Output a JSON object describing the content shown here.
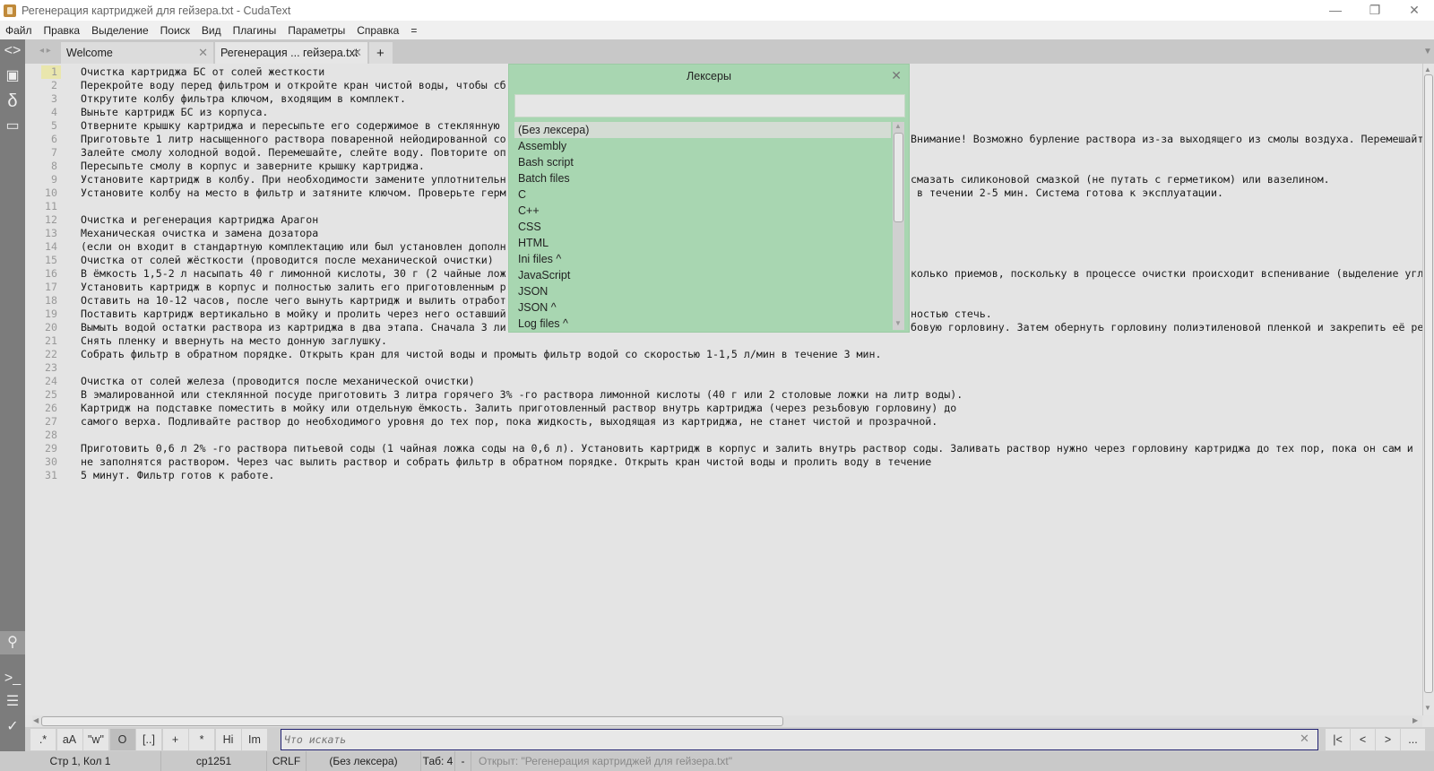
{
  "window": {
    "title": "Регенерация картриджей для гейзера.txt - CudaText",
    "minimize": "—",
    "restore": "❐",
    "close": "✕"
  },
  "menu": [
    "Файл",
    "Правка",
    "Выделение",
    "Поиск",
    "Вид",
    "Плагины",
    "Параметры",
    "Справка",
    "="
  ],
  "tabs": [
    {
      "label": "Welcome",
      "close": "✕"
    },
    {
      "label": "Регенерация ... гейзера.txt",
      "close": "✕"
    }
  ],
  "add_tab": "+",
  "lines": [
    {
      "n": "1",
      "t": "Очистка картриджа БС от солей жесткости"
    },
    {
      "n": "2",
      "t": "Перекройте воду перед фильтром и откройте кран чистой воды, чтобы сб"
    },
    {
      "n": "3",
      "t": "Открутите колбу фильтра ключом, входящим в комплект."
    },
    {
      "n": "4",
      "t": "Выньте картридж БС из корпуса."
    },
    {
      "n": "5",
      "t": "Отверните крышку картриджа и пересыпьте его содержимое в стеклянную"
    },
    {
      "n": "6",
      "t": "Приготовьте 1 литр насыщенного раствора поваренной нейодированной со",
      "r": "Внимание! Возможно бурление раствора из-за выходящего из смолы воздуха. Перемешайт"
    },
    {
      "n": "7",
      "t": "Залейте смолу холодной водой. Перемешайте, слейте воду. Повторите оп"
    },
    {
      "n": "8",
      "t": "Пересыпьте смолу в корпус и заверните крышку картриджа."
    },
    {
      "n": "9",
      "t": "Установите картридж в колбу. При необходимости замените уплотнительн",
      "r": "смазать силиконовой смазкой (не путать с герметиком) или вазелином."
    },
    {
      "n": "10",
      "t": "Установите колбу на место в фильтр и затяните ключом. Проверьте герм",
      "r": " в течении 2-5 мин. Система готова к эксплуатации."
    },
    {
      "n": "11",
      "t": ""
    },
    {
      "n": "12",
      "t": "Очистка и регенерация картриджа Арагон"
    },
    {
      "n": "13",
      "t": "Механическая очистка и замена дозатора"
    },
    {
      "n": "14",
      "t": "(если он входит в стандартную комплектацию или был установлен дополн"
    },
    {
      "n": "15",
      "t": "Очистка от солей жёсткости (проводится после механической очистки)"
    },
    {
      "n": "16",
      "t": "В ёмкость 1,5-2 л насыпать 40 г лимонной кислоты, 30 г (2 чайные лож",
      "r": "колько приемов, поскольку в процессе очистки происходит вспенивание (выделение угл"
    },
    {
      "n": "17",
      "t": "Установить картридж в корпус и полностью залить его приготовленным р"
    },
    {
      "n": "18",
      "t": "Оставить на 10-12 часов, после чего вынуть картридж и вылить отработ"
    },
    {
      "n": "19",
      "t": "Поставить картридж вертикально в мойку и пролить через него оставший",
      "r": "ностью стечь."
    },
    {
      "n": "20",
      "t": "Вымыть водой остатки раствора из картриджа в два этапа. Сначала 3 ли",
      "r": "бовую горловину. Затем обернуть горловину полиэтиленовой пленкой и закрепить её ре"
    },
    {
      "n": "21",
      "t": "Снять пленку и ввернуть на место донную заглушку."
    },
    {
      "n": "22",
      "t": "Собрать фильтр в обратном порядке. Открыть кран для чистой воды и промыть фильтр водой со скоростью 1-1,5 л/мин в течение 3 мин."
    },
    {
      "n": "23",
      "t": ""
    },
    {
      "n": "24",
      "t": "Очистка от солей железа (проводится после механической очистки)"
    },
    {
      "n": "25",
      "t": "В эмалированной или стеклянной посуде приготовить 3 литра горячего 3% -го раствора лимонной кислоты (40 г или 2 столовые ложки на литр воды)."
    },
    {
      "n": "26",
      "t": "Картридж на подставке поместить в мойку или отдельную ёмкость. Залить приготовленный раствор внутрь картриджа (через резьбовую горловину) до"
    },
    {
      "n": "27",
      "t": "самого верха. Подливайте раствор до необходимого уровня до тех пор, пока жидкость, выходящая из картриджа, не станет чистой и прозрачной."
    },
    {
      "n": "28",
      "t": ""
    },
    {
      "n": "29",
      "t": "Приготовить 0,6 л 2% -го раствора питьевой соды (1 чайная ложка соды на 0,6 л). Установить картридж в корпус и залить внутрь раствор соды. Заливать раствор нужно через горловину картриджа до тех пор, пока он сам и"
    },
    {
      "n": "30",
      "t": "не заполнятся раствором. Через час вылить раствор и собрать фильтр в обратном порядке. Открыть кран чистой воды и пролить воду в течение"
    },
    {
      "n": "31",
      "t": "5 минут. Фильтр готов к работе."
    }
  ],
  "lexer_popup": {
    "title": "Лексеры",
    "close": "✕",
    "filter_value": "",
    "items": [
      "(Без лексера)",
      "Assembly",
      "Bash script",
      "Batch files",
      "C",
      "C++",
      "CSS",
      "HTML",
      "Ini files ^",
      "JavaScript",
      "JSON",
      "JSON ^",
      "Log files ^"
    ]
  },
  "find": {
    "buttons": [
      ".*",
      "aA",
      "\"w\"",
      "O",
      "[..]",
      "+",
      "*",
      "Hi",
      "Im"
    ],
    "placeholder": "Что искать",
    "value": "",
    "clear": "✕",
    "nav": [
      "|<",
      "<",
      ">",
      "..."
    ]
  },
  "status": {
    "position": "Стр 1, Кол 1",
    "encoding": "cp1251",
    "line_ending": "CRLF",
    "lexer": "(Без лексера)",
    "tab": "Таб: 4",
    "sep": "-",
    "message": "Открыт: \"Регенерация картриджей для гейзера.txt\""
  },
  "colors": {
    "popup": "#a8d6b1",
    "sidebar": "#7c7c7c",
    "editor": "#e4e4e4"
  }
}
